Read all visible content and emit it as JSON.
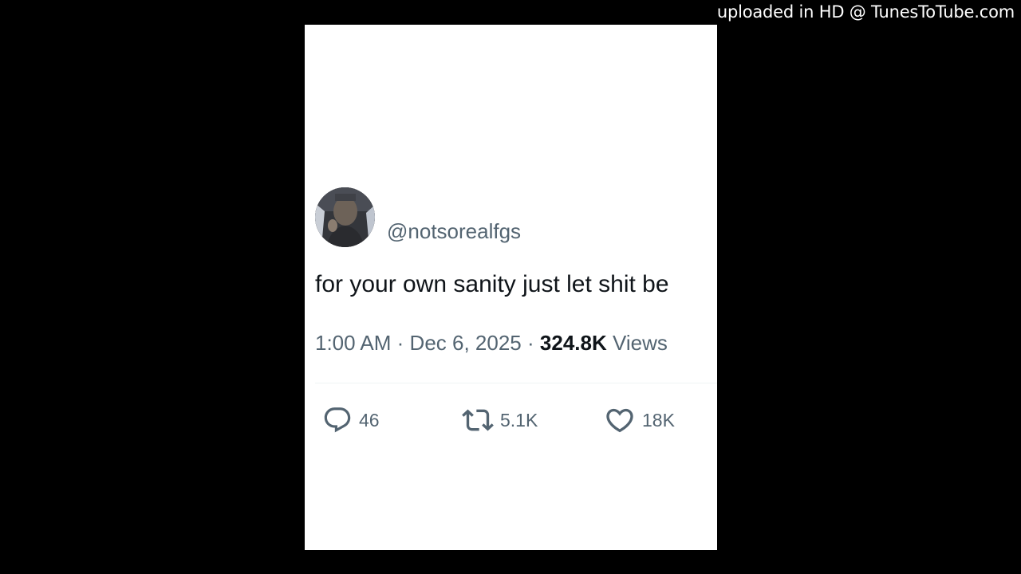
{
  "watermark": "uploaded in HD @ TunesToTube.com",
  "tweet": {
    "handle": "@notsorealfgs",
    "text": "for your own sanity just let shit be",
    "time": "1:00 AM",
    "separator": "·",
    "date": "Dec 6, 2025",
    "views_count": "324.8K",
    "views_label": "Views"
  },
  "actions": {
    "replies": "46",
    "retweets": "5.1K",
    "likes": "18K"
  },
  "colors": {
    "background": "#000000",
    "card": "#ffffff",
    "text": "#0f1419",
    "secondary_text": "#536471"
  }
}
